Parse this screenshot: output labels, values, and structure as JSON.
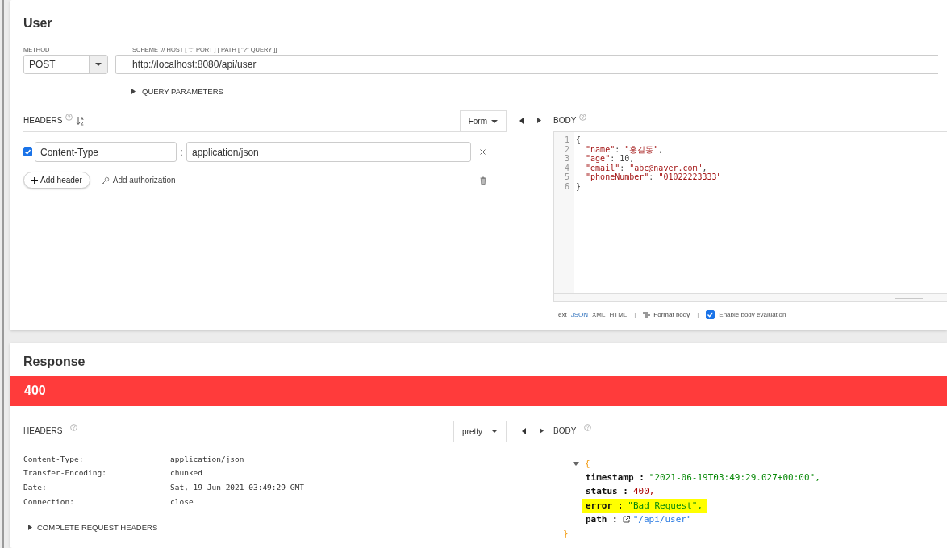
{
  "request": {
    "title": "User",
    "method_label": "METHOD",
    "method": "POST",
    "url_label": "SCHEME :// HOST [ \":\" PORT ] [ PATH [ \"?\" QUERY ]]",
    "url": "http://localhost:8080/api/user",
    "query_parameters": "QUERY PARAMETERS",
    "headers": {
      "title": "HEADERS",
      "mode": "Form",
      "items": [
        {
          "checked": true,
          "name": "Content-Type",
          "separator": ":",
          "value": "application/json"
        }
      ],
      "add_header": "Add header",
      "add_authorization": "Add authorization"
    },
    "body": {
      "title": "BODY",
      "lines": [
        {
          "number": "1",
          "code": "{"
        },
        {
          "number": "2",
          "code": "  \"name\": \"홍길동\","
        },
        {
          "number": "3",
          "code": "  \"age\": 10,"
        },
        {
          "number": "4",
          "code": "  \"email\": \"abc@naver.com\","
        },
        {
          "number": "5",
          "code": "  \"phoneNumber\": \"01022223333\""
        },
        {
          "number": "6",
          "code": "}"
        }
      ],
      "formats": [
        "Text",
        "JSON",
        "XML",
        "HTML"
      ],
      "separator": "|",
      "format_body": "Format body",
      "enable_evaluation": {
        "label": "Enable body evaluation",
        "checked": true
      }
    }
  },
  "response": {
    "title": "Response",
    "status": "400",
    "headers": {
      "title": "HEADERS",
      "mode": "pretty",
      "items": [
        {
          "name": "Content-Type:",
          "value": "application/json"
        },
        {
          "name": "Transfer-Encoding:",
          "value": "chunked"
        },
        {
          "name": "Date:",
          "value": "Sat, 19 Jun 2021 03:49:29 GMT"
        },
        {
          "name": "Connection:",
          "value": "close"
        }
      ],
      "complete": "COMPLETE REQUEST HEADERS"
    },
    "body": {
      "title": "BODY",
      "open_brace": "{",
      "close_brace": "}",
      "entries": [
        {
          "key": "timestamp :",
          "value": "\"2021-06-19T03:49:29.027+00:00\",",
          "kind": "string",
          "highlighted": false
        },
        {
          "key": "status :",
          "value": "400,",
          "kind": "number",
          "highlighted": false
        },
        {
          "key": "error :",
          "value": "\"Bad Request\",",
          "kind": "string",
          "highlighted": true
        },
        {
          "key": "path :",
          "value": "\"/api/user\"",
          "kind": "link",
          "highlighted": false
        }
      ]
    }
  }
}
